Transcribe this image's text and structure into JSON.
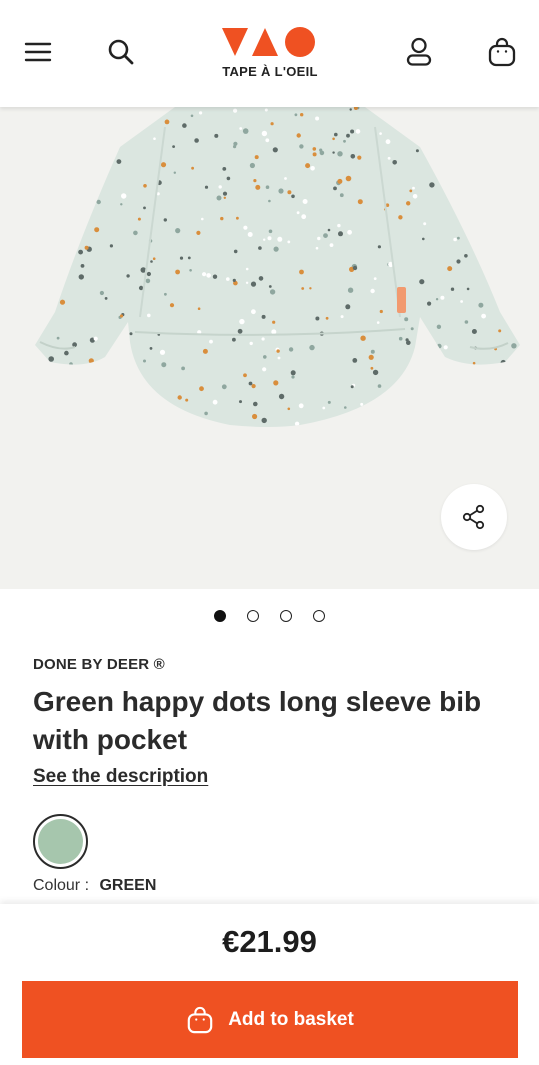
{
  "header": {
    "logo_text": "TAPE À L'OEIL",
    "brand_colors": {
      "primary": "#ef5122"
    },
    "icons": [
      "menu-icon",
      "search-icon",
      "account-icon",
      "bag-icon"
    ]
  },
  "gallery": {
    "image_background": "#f2f2ef",
    "bib_color": "#dbe6e0",
    "dot_colors": [
      "#5e6b68",
      "#d98e3c",
      "#8fa79f",
      "#ffffff"
    ],
    "slide_count": 4,
    "active_slide": 1
  },
  "product": {
    "brand": "DONE BY DEER ®",
    "title": "Green happy dots long sleeve bib with pocket",
    "description_link": "See the description",
    "colour_label": "Colour :",
    "colour_value": "GREEN",
    "swatch_color": "#a6c6ad"
  },
  "purchase": {
    "price": "€21.99",
    "add_button_label": "Add to basket",
    "button_color": "#ef5122"
  }
}
